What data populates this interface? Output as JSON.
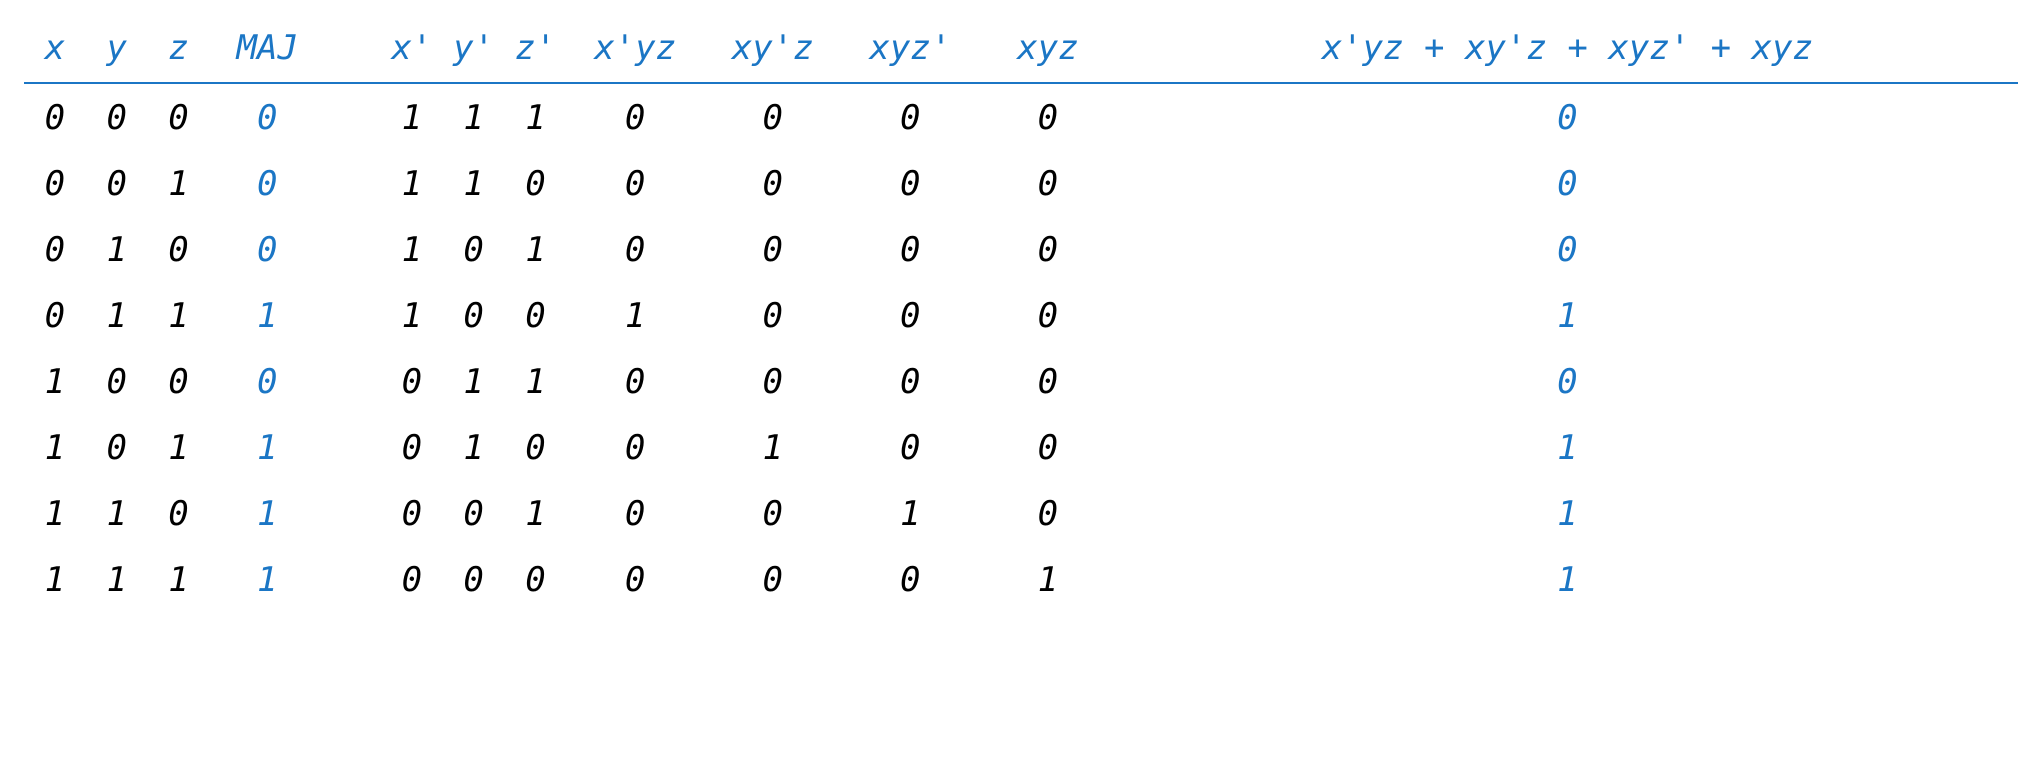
{
  "chart_data": {
    "type": "table",
    "title": "",
    "columns": [
      "x",
      "y",
      "z",
      "MAJ",
      "x'",
      "y'",
      "z'",
      "x'yz",
      "xy'z",
      "xyz'",
      "xyz",
      "x'yz + xy'z + xyz' + xyz"
    ],
    "highlight_columns": [
      3,
      11
    ],
    "rows": [
      [
        "0",
        "0",
        "0",
        "0",
        "1",
        "1",
        "1",
        "0",
        "0",
        "0",
        "0",
        "0"
      ],
      [
        "0",
        "0",
        "1",
        "0",
        "1",
        "1",
        "0",
        "0",
        "0",
        "0",
        "0",
        "0"
      ],
      [
        "0",
        "1",
        "0",
        "0",
        "1",
        "0",
        "1",
        "0",
        "0",
        "0",
        "0",
        "0"
      ],
      [
        "0",
        "1",
        "1",
        "1",
        "1",
        "0",
        "0",
        "1",
        "0",
        "0",
        "0",
        "1"
      ],
      [
        "1",
        "0",
        "0",
        "0",
        "0",
        "1",
        "1",
        "0",
        "0",
        "0",
        "0",
        "0"
      ],
      [
        "1",
        "0",
        "1",
        "1",
        "0",
        "1",
        "0",
        "0",
        "1",
        "0",
        "0",
        "1"
      ],
      [
        "1",
        "1",
        "0",
        "1",
        "0",
        "0",
        "1",
        "0",
        "0",
        "1",
        "0",
        "1"
      ],
      [
        "1",
        "1",
        "1",
        "1",
        "0",
        "0",
        "0",
        "0",
        "0",
        "0",
        "1",
        "1"
      ]
    ]
  }
}
